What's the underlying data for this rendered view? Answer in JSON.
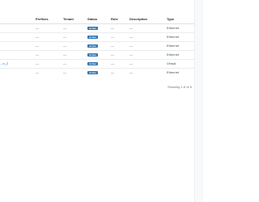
{
  "table": {
    "columns": [
      "Prefixes",
      "Tenant",
      "Status",
      "Role",
      "Description",
      "Type"
    ],
    "rows": [
      {
        "name": "",
        "prefixes": "—",
        "tenant": "—",
        "status": "Active",
        "role": "—",
        "description": "—",
        "type": "Ethernet"
      },
      {
        "name": "",
        "prefixes": "—",
        "tenant": "—",
        "status": "Active",
        "role": "—",
        "description": "—",
        "type": "Ethernet"
      },
      {
        "name": "",
        "prefixes": "—",
        "tenant": "—",
        "status": "Active",
        "role": "—",
        "description": "—",
        "type": "Ethernet"
      },
      {
        "name": "",
        "prefixes": "—",
        "tenant": "—",
        "status": "Active",
        "role": "—",
        "description": "—",
        "type": "Ethernet"
      },
      {
        "name": "...e_2",
        "prefixes": "—",
        "tenant": "—",
        "status": "Active",
        "role": "—",
        "description": "—",
        "type": "Virtual"
      },
      {
        "name": "",
        "prefixes": "—",
        "tenant": "—",
        "status": "Active",
        "role": "—",
        "description": "—",
        "type": "Ethernet"
      }
    ]
  },
  "pagination": {
    "summary": "Showing 1-6 of 6"
  },
  "colors": {
    "status_active": "#2f74b5",
    "link": "#0d6efd"
  }
}
